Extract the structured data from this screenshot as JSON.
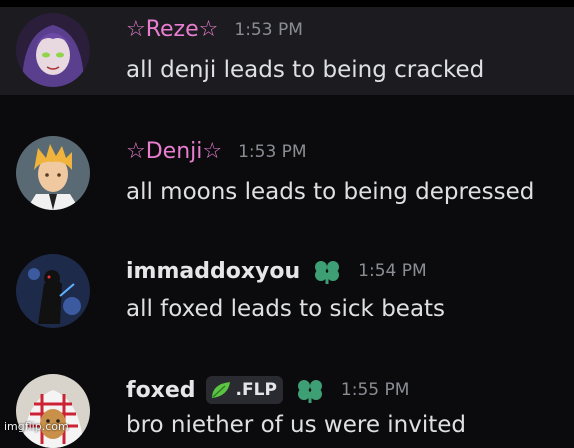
{
  "messages": [
    {
      "username": "☆Reze☆",
      "timestamp": "1:53 PM",
      "text": "all denji leads to being cracked",
      "name_color": "#e87ed0"
    },
    {
      "username": "☆Denji☆",
      "timestamp": "1:53 PM",
      "text": "all moons leads to being depressed",
      "name_color": "#e87ed0"
    },
    {
      "username": "immaddoxyou",
      "timestamp": "1:54 PM",
      "text": "all foxed leads to sick beats",
      "badge_icon": "clover-icon"
    },
    {
      "username": "foxed",
      "timestamp": "1:55 PM",
      "text": "bro niether of us were invited",
      "tag": ".FLP",
      "tag_icon": "leaf-icon",
      "badge_icon": "clover-icon"
    }
  ],
  "watermark": "imgflip.com",
  "colors": {
    "background": "#0b0b0d",
    "highlight": "#1c1c20",
    "timestamp": "#8b8d94",
    "clover": "#3f9f74"
  }
}
